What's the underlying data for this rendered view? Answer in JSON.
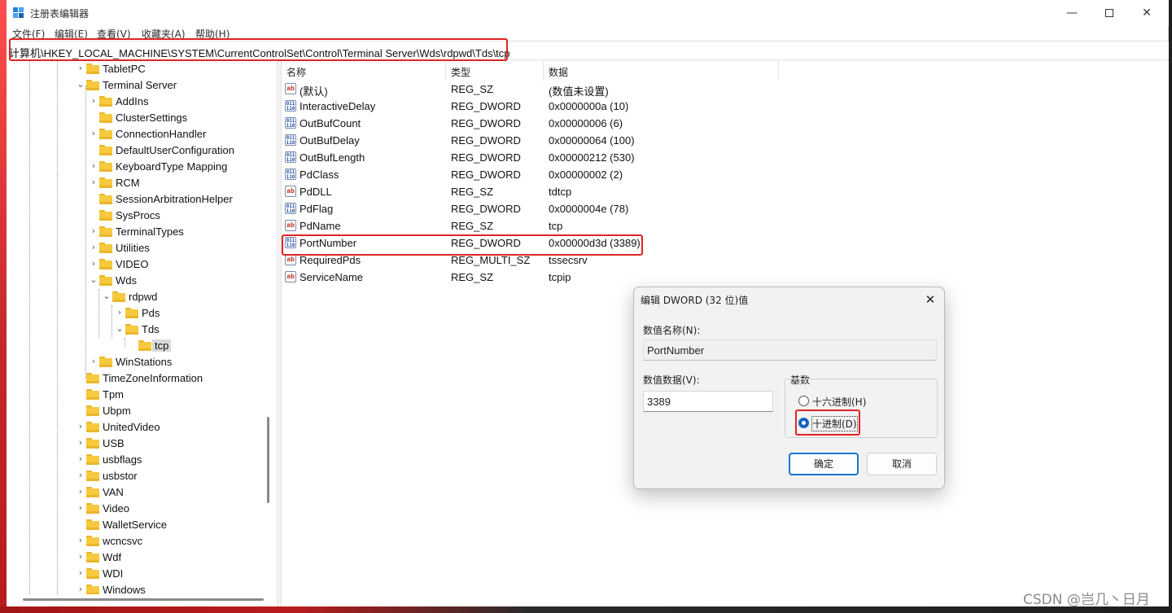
{
  "window": {
    "title": "注册表编辑器"
  },
  "menu": [
    "文件(F)",
    "编辑(E)",
    "查看(V)",
    "收藏夹(A)",
    "帮助(H)"
  ],
  "address": "计算机\\HKEY_LOCAL_MACHINE\\SYSTEM\\CurrentControlSet\\Control\\Terminal Server\\Wds\\rdpwd\\Tds\\tcp",
  "tree": [
    {
      "label": "TabletPC"
    },
    {
      "label": "Terminal Server"
    },
    {
      "label": "AddIns"
    },
    {
      "label": "ClusterSettings"
    },
    {
      "label": "ConnectionHandler"
    },
    {
      "label": "DefaultUserConfiguration"
    },
    {
      "label": "KeyboardType Mapping"
    },
    {
      "label": "RCM"
    },
    {
      "label": "SessionArbitrationHelper"
    },
    {
      "label": "SysProcs"
    },
    {
      "label": "TerminalTypes"
    },
    {
      "label": "Utilities"
    },
    {
      "label": "VIDEO"
    },
    {
      "label": "Wds"
    },
    {
      "label": "rdpwd"
    },
    {
      "label": "Pds"
    },
    {
      "label": "Tds"
    },
    {
      "label": "tcp"
    },
    {
      "label": "WinStations"
    },
    {
      "label": "TimeZoneInformation"
    },
    {
      "label": "Tpm"
    },
    {
      "label": "Ubpm"
    },
    {
      "label": "UnitedVideo"
    },
    {
      "label": "USB"
    },
    {
      "label": "usbflags"
    },
    {
      "label": "usbstor"
    },
    {
      "label": "VAN"
    },
    {
      "label": "Video"
    },
    {
      "label": "WalletService"
    },
    {
      "label": "wcncsvc"
    },
    {
      "label": "Wdf"
    },
    {
      "label": "WDI"
    },
    {
      "label": "Windows"
    }
  ],
  "columns": [
    "名称",
    "类型",
    "数据"
  ],
  "values": [
    {
      "name": "(默认)",
      "type": "REG_SZ",
      "data": "(数值未设置)",
      "icon": "string-value-icon"
    },
    {
      "name": "InteractiveDelay",
      "type": "REG_DWORD",
      "data": "0x0000000a (10)",
      "icon": "binary-value-icon"
    },
    {
      "name": "OutBufCount",
      "type": "REG_DWORD",
      "data": "0x00000006 (6)",
      "icon": "binary-value-icon"
    },
    {
      "name": "OutBufDelay",
      "type": "REG_DWORD",
      "data": "0x00000064 (100)",
      "icon": "binary-value-icon"
    },
    {
      "name": "OutBufLength",
      "type": "REG_DWORD",
      "data": "0x00000212 (530)",
      "icon": "binary-value-icon"
    },
    {
      "name": "PdClass",
      "type": "REG_DWORD",
      "data": "0x00000002 (2)",
      "icon": "binary-value-icon"
    },
    {
      "name": "PdDLL",
      "type": "REG_SZ",
      "data": "tdtcp",
      "icon": "string-value-icon"
    },
    {
      "name": "PdFlag",
      "type": "REG_DWORD",
      "data": "0x0000004e (78)",
      "icon": "binary-value-icon"
    },
    {
      "name": "PdName",
      "type": "REG_SZ",
      "data": "tcp",
      "icon": "string-value-icon"
    },
    {
      "name": "PortNumber",
      "type": "REG_DWORD",
      "data": "0x00000d3d (3389)",
      "icon": "binary-value-icon"
    },
    {
      "name": "RequiredPds",
      "type": "REG_MULTI_SZ",
      "data": "tssecsrv",
      "icon": "string-value-icon"
    },
    {
      "name": "ServiceName",
      "type": "REG_SZ",
      "data": "tcpip",
      "icon": "string-value-icon"
    }
  ],
  "dialog": {
    "title": "编辑 DWORD (32 位)值",
    "name_label": "数值名称(N):",
    "name_value": "PortNumber",
    "data_label": "数值数据(V):",
    "data_value": "3389",
    "base_label": "基数",
    "hex_label": "十六进制(H)",
    "dec_label": "十进制(D)",
    "selected_base": "十进制(D)",
    "ok": "确定",
    "cancel": "取消"
  },
  "icons": {
    "ab": "ab",
    "dword": "011\n110"
  },
  "watermark": "CSDN @岂几丶日月",
  "colors": {
    "highlight": "#e02424",
    "folder": "#f6c93e",
    "accent": "#1976d2"
  }
}
